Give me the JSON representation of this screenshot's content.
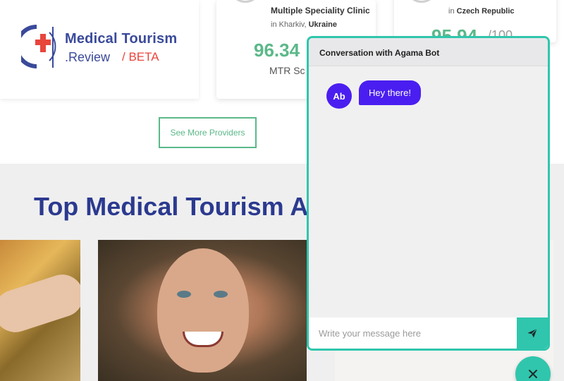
{
  "brand": {
    "name": "Medical Tourism",
    "sub": ".Review",
    "beta": "/ BETA",
    "colors": {
      "primary": "#3a4a9a",
      "accent": "#e8453c",
      "green": "#5bb889",
      "teal": "#2fc6ad",
      "purple": "#4a1ef0"
    }
  },
  "providers": [
    {
      "name": "Multiple Speciality Clinic",
      "location_prefix": "in Kharkiv,",
      "country": "Ukraine",
      "score": "96.34",
      "score_label": "MTR Sc"
    },
    {
      "location_prefix": "in",
      "country": "Czech Republic",
      "score": "95.94",
      "score_suffix": "/100"
    }
  ],
  "see_more_label": "See More Providers",
  "section_title": "Top Medical Tourism A",
  "chat": {
    "title": "Conversation with Agama Bot",
    "avatar_initials": "Ab",
    "messages": [
      {
        "from": "bot",
        "text": "Hey there!"
      }
    ],
    "input_placeholder": "Write your message here",
    "send_icon": "paper-plane-icon",
    "close_icon": "close-icon"
  }
}
